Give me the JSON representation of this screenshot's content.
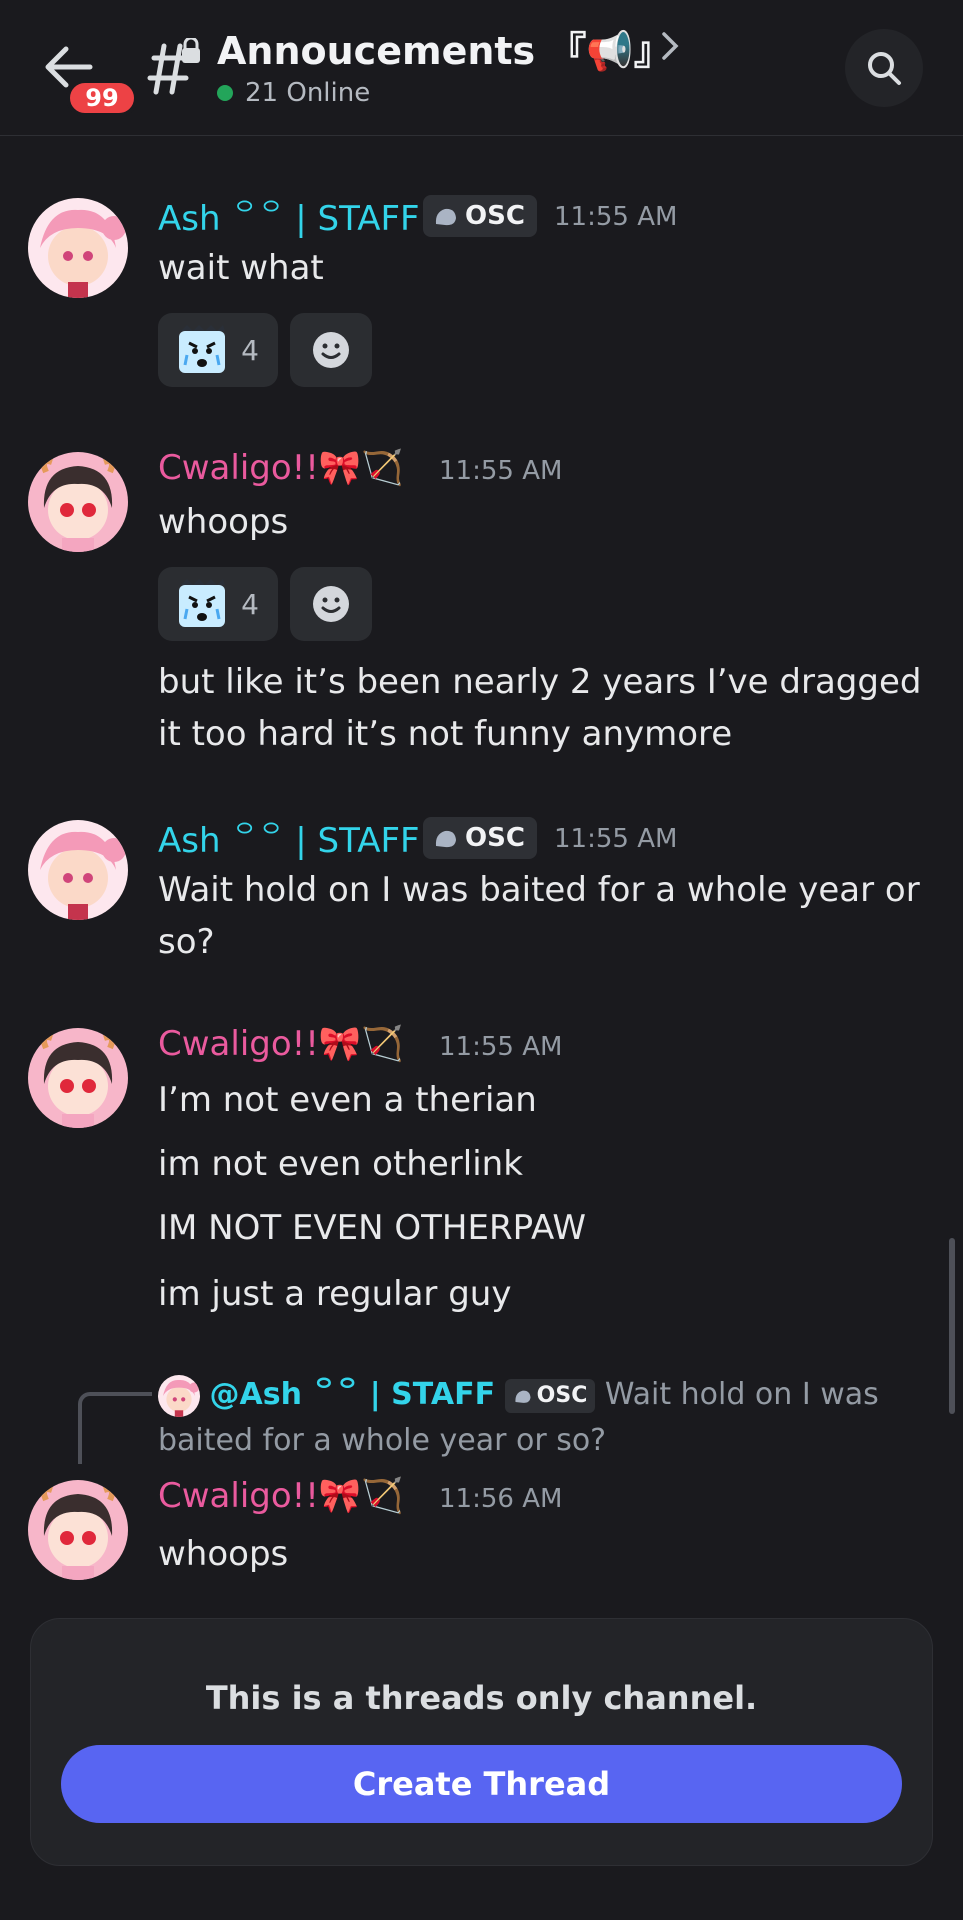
{
  "header": {
    "unread_badge": "99",
    "channel_name": "Annoucements 『📢』",
    "online_text": "21 Online"
  },
  "messages": [
    {
      "username": "Ash ꒪꒪ | STAFF",
      "tag": "OSC",
      "time": "11:55 AM",
      "lines": [
        "wait what"
      ],
      "reaction_count": "4"
    },
    {
      "username": "Cwaligo!!🎀🏹",
      "time": "11:55 AM",
      "lines": [
        "whoops"
      ],
      "reaction_count": "4",
      "extra_lines": [
        "but like it’s been nearly 2 years I’ve dragged it too hard it’s not funny anymore"
      ]
    },
    {
      "username": "Ash ꒪꒪ | STAFF",
      "tag": "OSC",
      "time": "11:55 AM",
      "lines": [
        "Wait hold on I was baited for a whole year or so?"
      ]
    },
    {
      "username": "Cwaligo!!🎀🏹",
      "time": "11:55 AM",
      "lines": [
        "I’m not even a therian",
        "im not even otherlink",
        "IM NOT EVEN OTHERPAW",
        "im just a regular guy"
      ]
    },
    {
      "reply_to": {
        "mention": "@Ash ꒪꒪ | STAFF",
        "tag": "OSC",
        "text": "Wait hold on I was baited for a whole year or so?"
      },
      "username": "Cwaligo!!🎀🏹",
      "time": "11:56 AM",
      "lines": [
        "whoops"
      ]
    }
  ],
  "footer": {
    "notice": "This is a threads only channel.",
    "button": "Create Thread"
  },
  "colors": {
    "background": "#1a1a1e",
    "staff_name": "#33d4ea",
    "user_name": "#ea5a9e",
    "accent": "#5865f2",
    "badge": "#ed4245",
    "online": "#23a55a"
  }
}
